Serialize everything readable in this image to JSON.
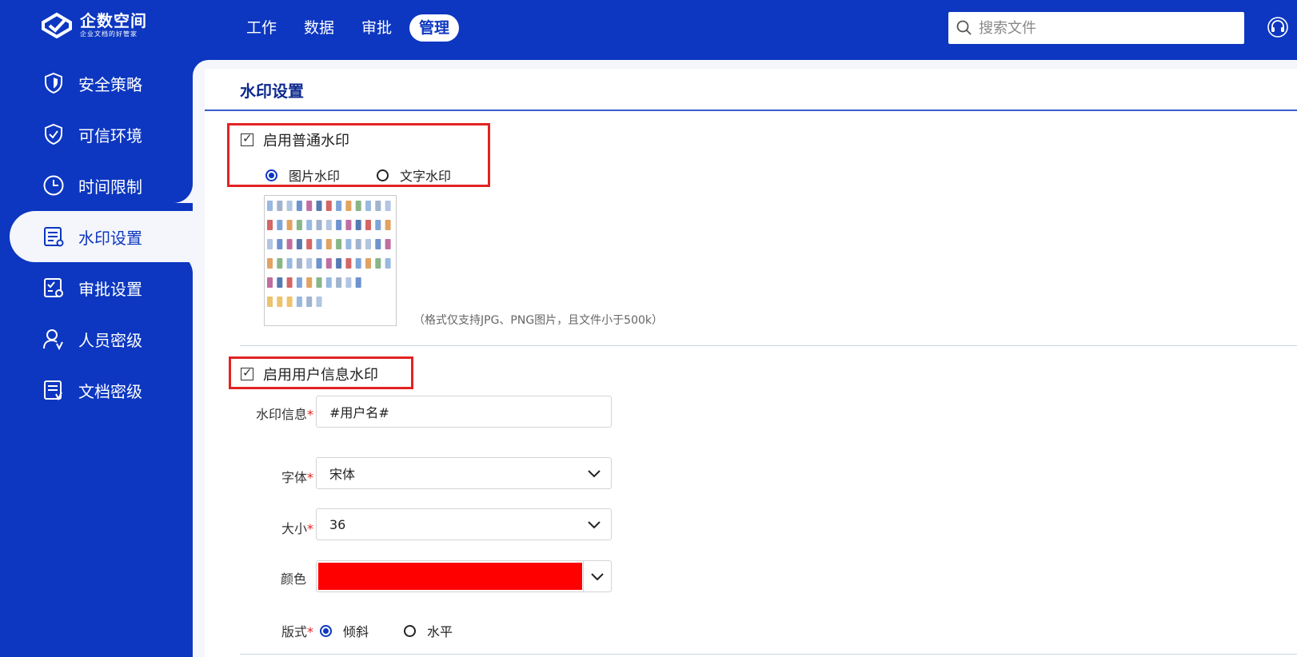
{
  "app": {
    "logo_title": "企数空间",
    "logo_subtitle": "企业文档的好管家"
  },
  "nav": {
    "items": [
      {
        "label": "工作"
      },
      {
        "label": "数据"
      },
      {
        "label": "审批"
      },
      {
        "label": "管理",
        "active": true
      }
    ]
  },
  "search": {
    "placeholder": "搜索文件"
  },
  "sidebar": {
    "items": [
      {
        "label": "安全策略",
        "icon": "shield-icon"
      },
      {
        "label": "可信环境",
        "icon": "shield-check-icon"
      },
      {
        "label": "时间限制",
        "icon": "clock-icon"
      },
      {
        "label": "水印设置",
        "icon": "watermark-doc-icon",
        "active": true
      },
      {
        "label": "审批设置",
        "icon": "approval-doc-icon"
      },
      {
        "label": "人员密级",
        "icon": "user-level-icon"
      },
      {
        "label": "文档密级",
        "icon": "doc-level-icon"
      }
    ]
  },
  "page": {
    "title": "水印设置"
  },
  "normal_watermark": {
    "label": "启用普通水印",
    "checked": true,
    "options": [
      {
        "label": "图片水印",
        "selected": true
      },
      {
        "label": "文字水印",
        "selected": false
      }
    ],
    "hint": "（格式仅支持JPG、PNG图片，且文件小于500k）"
  },
  "user_watermark": {
    "label": "启用用户信息水印",
    "checked": true,
    "info_label": "水印信息",
    "info_value": "#用户名#",
    "font_label": "字体",
    "font_value": "宋体",
    "size_label": "大小",
    "size_value": "36",
    "color_label": "颜色",
    "color_value": "#ff0000",
    "layout_label": "版式",
    "layout_options": [
      {
        "label": "倾斜",
        "selected": true
      },
      {
        "label": "水平",
        "selected": false
      }
    ],
    "required_mark": "*"
  },
  "colors": {
    "brand": "#0d37c0",
    "highlight_border": "#e32222"
  }
}
